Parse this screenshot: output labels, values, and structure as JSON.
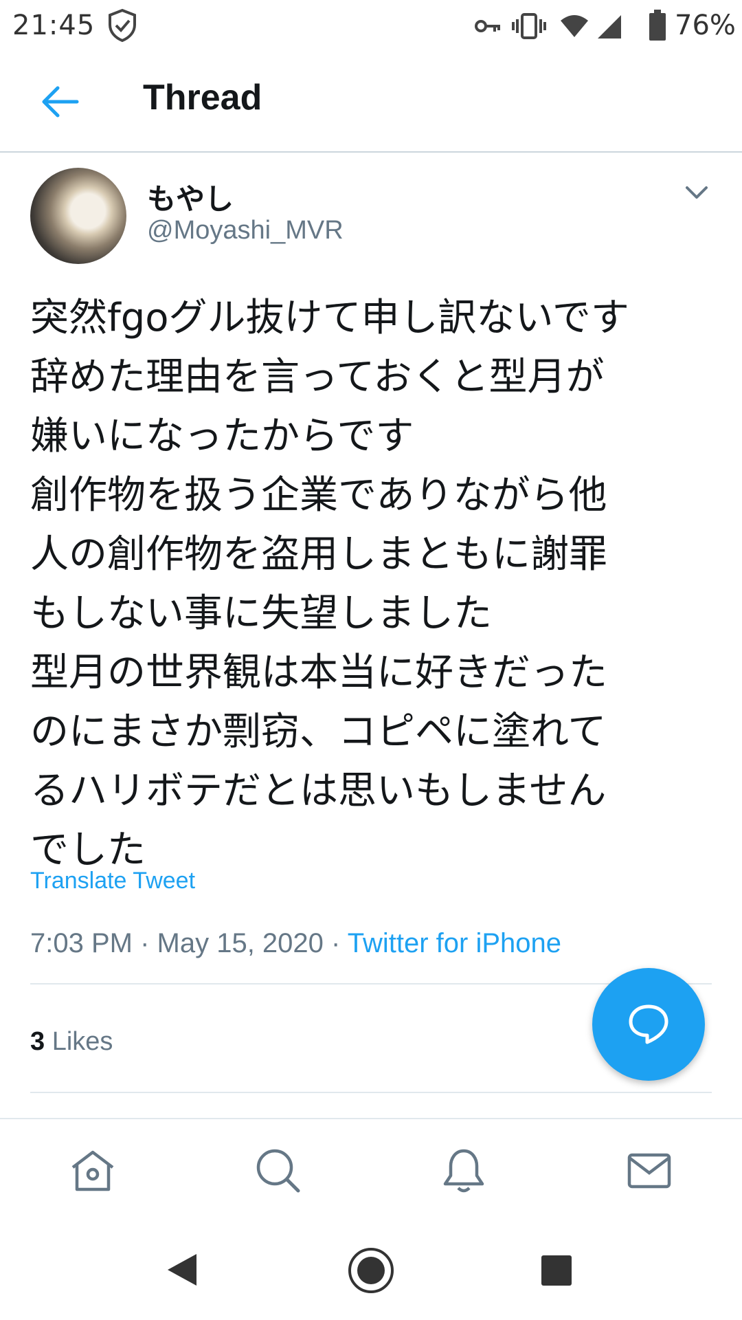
{
  "status_bar": {
    "time": "21:45",
    "battery_percent": "76%",
    "icons": [
      "shield-check-icon",
      "vpn-key-icon",
      "vibrate-icon",
      "wifi-icon",
      "cell-signal-icon",
      "battery-icon"
    ]
  },
  "header": {
    "title": "Thread",
    "back_icon": "arrow-left-icon"
  },
  "tweet": {
    "display_name": "もやし",
    "handle": "@Moyashi_MVR",
    "menu_icon": "chevron-down-icon",
    "text_lines": [
      "突然fgoグル抜けて申し訳ないです",
      "辞めた理由を言っておくと型月が",
      "嫌いになったからです",
      "創作物を扱う企業でありながら他",
      "人の創作物を盗用しまともに謝罪",
      "もしない事に失望しました",
      "型月の世界観は本当に好きだった",
      "のにまさか剽窃、コピペに塗れて",
      "るハリボテだとは思いもしません",
      "でした"
    ],
    "translate_label": "Translate Tweet",
    "time": "7:03 PM",
    "date": "May 15, 2020",
    "source": "Twitter for iPhone",
    "likes_count": "3",
    "likes_label": "Likes"
  },
  "fab": {
    "icon": "reply-bubble-icon"
  },
  "tab_bar": {
    "items": [
      {
        "name": "home",
        "icon": "home-icon"
      },
      {
        "name": "search",
        "icon": "search-icon"
      },
      {
        "name": "notifications",
        "icon": "bell-icon"
      },
      {
        "name": "messages",
        "icon": "mail-icon"
      }
    ]
  },
  "nav_bar": {
    "icons": [
      "back-triangle-icon",
      "home-circle-icon",
      "recents-square-icon"
    ]
  },
  "colors": {
    "accent": "#1da1f2",
    "text_primary": "#14171a",
    "text_secondary": "#657786",
    "divider": "#e1e8ed"
  }
}
